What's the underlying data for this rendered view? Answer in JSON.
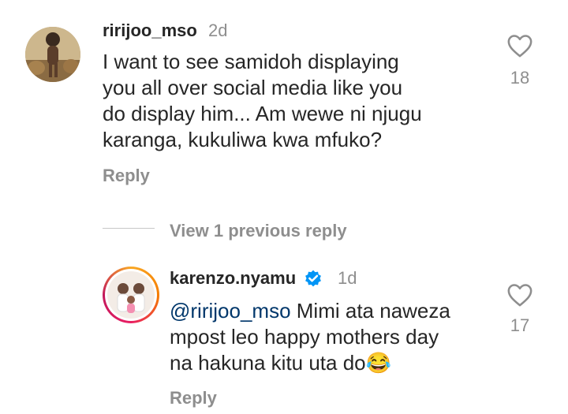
{
  "comment1": {
    "username": "ririjoo_mso",
    "age": "2d",
    "lines": [
      "I want to see samidoh displaying",
      "you all over social media like you",
      "do display him... Am wewe ni njugu",
      "karanga, kukuliwa kwa mfuko?"
    ],
    "likes": "18",
    "reply_label": "Reply"
  },
  "view_replies_label": "View 1 previous reply",
  "comment2": {
    "username": "karenzo.nyamu",
    "age": "1d",
    "mention": "@ririjoo_mso",
    "line1_rest": " Mimi ata naweza",
    "line2": "mpost leo happy mothers day",
    "line3": "na hakuna kitu uta do",
    "emoji": "😂",
    "likes": "17",
    "reply_label": "Reply"
  },
  "colors": {
    "text": "#262626",
    "secondary": "#8e8e8e",
    "mention": "#00376b",
    "verified": "#0095f6"
  },
  "icons": [
    "heart-icon",
    "verified-badge-icon"
  ]
}
